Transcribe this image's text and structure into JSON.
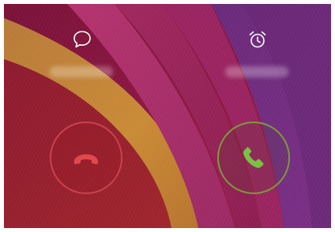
{
  "screen": {
    "background": "purple-orange-ribbon-wallpaper"
  },
  "quick_actions": {
    "message": {
      "icon": "chat-bubble-icon",
      "label": ""
    },
    "alarm": {
      "icon": "alarm-clock-icon",
      "label": ""
    }
  },
  "call_controls": {
    "decline": {
      "icon": "phone-hangup-icon",
      "color": "#e2474e",
      "ring_color": "#c9424f"
    },
    "answer": {
      "icon": "phone-answer-icon",
      "color": "#7bc043",
      "ring_color": "#7f9a3a"
    }
  }
}
